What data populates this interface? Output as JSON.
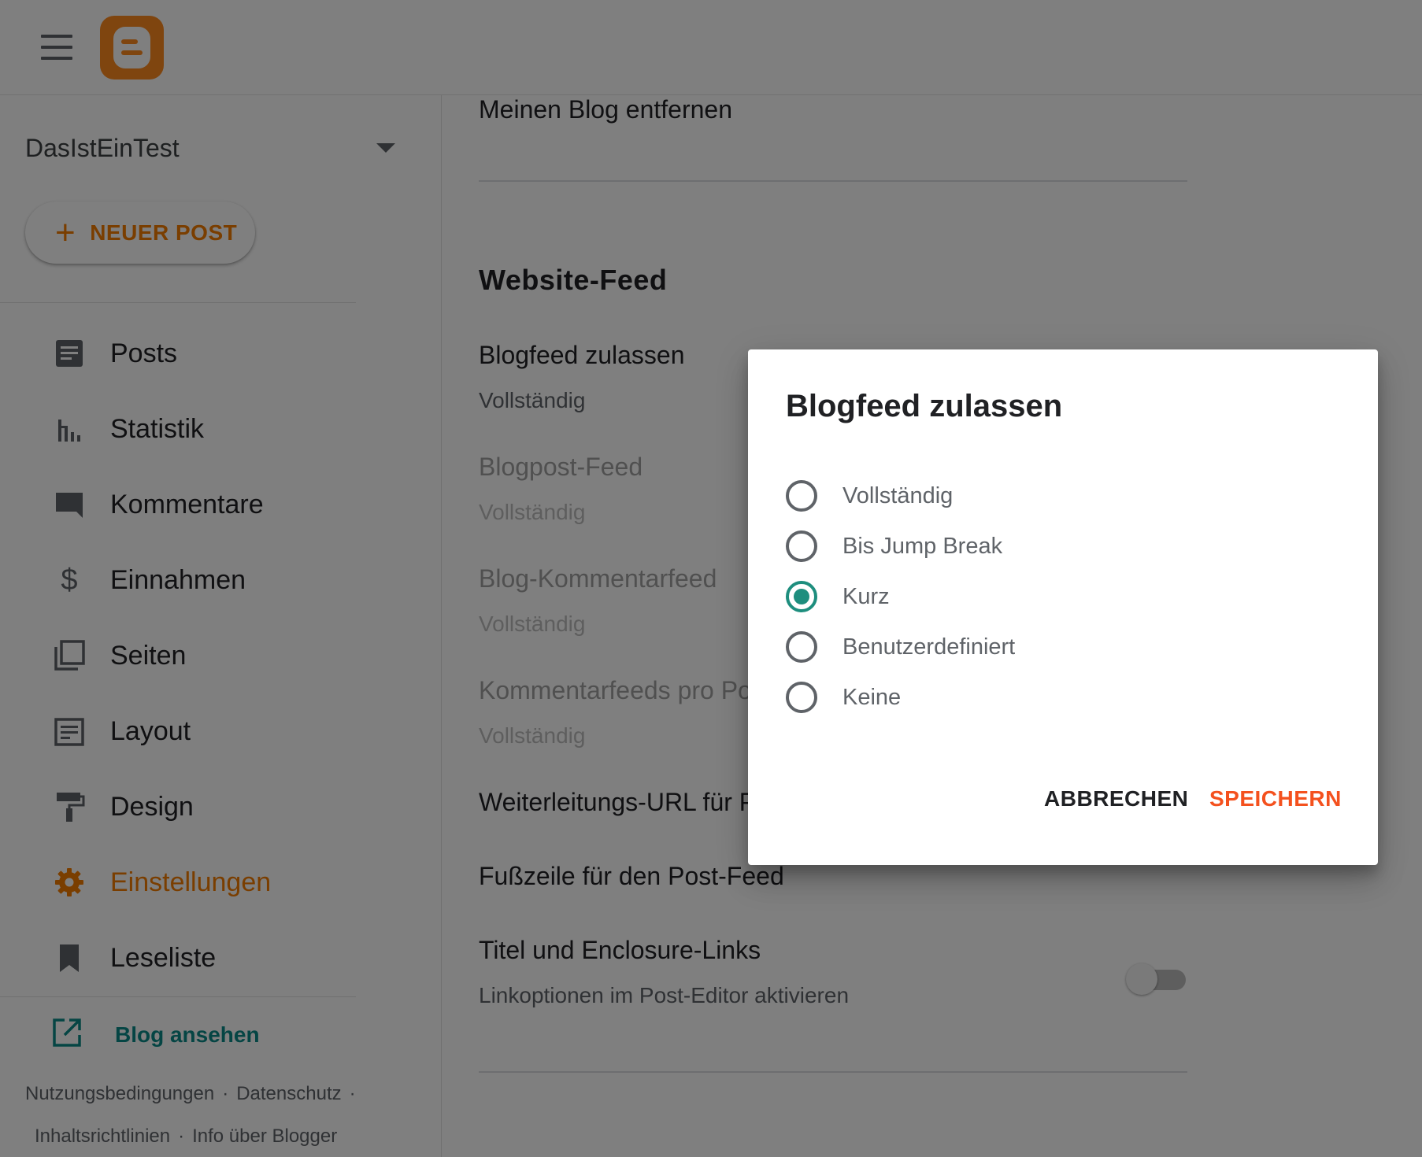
{
  "app": {
    "brand": "Blogger",
    "accent_color": "#f57c00",
    "logo_icon": "blogger-logo-icon"
  },
  "sidebar": {
    "blog_name": "DasIstEinTest",
    "new_post_label": "NEUER POST",
    "items": [
      {
        "label": "Posts",
        "icon": "posts-icon"
      },
      {
        "label": "Statistik",
        "icon": "stats-icon"
      },
      {
        "label": "Kommentare",
        "icon": "comment-icon"
      },
      {
        "label": "Einnahmen",
        "icon": "dollar-icon"
      },
      {
        "label": "Seiten",
        "icon": "pages-icon"
      },
      {
        "label": "Layout",
        "icon": "layout-icon"
      },
      {
        "label": "Design",
        "icon": "paint-roller-icon"
      },
      {
        "label": "Einstellungen",
        "icon": "gear-icon",
        "active": true
      },
      {
        "label": "Leseliste",
        "icon": "bookmark-icon"
      }
    ],
    "view_blog_label": "Blog ansehen",
    "footer_links": [
      "Nutzungsbedingungen",
      "Datenschutz",
      "Inhaltsrichtlinien",
      "Info über Blogger"
    ]
  },
  "main": {
    "remove_blog_label": "Meinen Blog entfernen",
    "section_title": "Website-Feed",
    "settings": [
      {
        "title": "Blogfeed zulassen",
        "value": "Vollständig"
      },
      {
        "title": "Blogpost-Feed",
        "value": "Vollständig"
      },
      {
        "title": "Blog-Kommentarfeed",
        "value": "Vollständig"
      },
      {
        "title": "Kommentarfeeds pro Po",
        "value": "Vollständig"
      },
      {
        "title": "Weiterleitungs-URL für P"
      },
      {
        "title": "Fußzeile für den Post-Feed"
      },
      {
        "title": "Titel und Enclosure-Links",
        "value": "Linkoptionen im Post-Editor aktivieren",
        "toggle_on": false
      }
    ]
  },
  "dialog": {
    "title": "Blogfeed zulassen",
    "options": [
      "Vollständig",
      "Bis Jump Break",
      "Kurz",
      "Benutzerdefiniert",
      "Keine"
    ],
    "selected": "Kurz",
    "cancel_label": "ABBRECHEN",
    "save_label": "SPEICHERN"
  }
}
